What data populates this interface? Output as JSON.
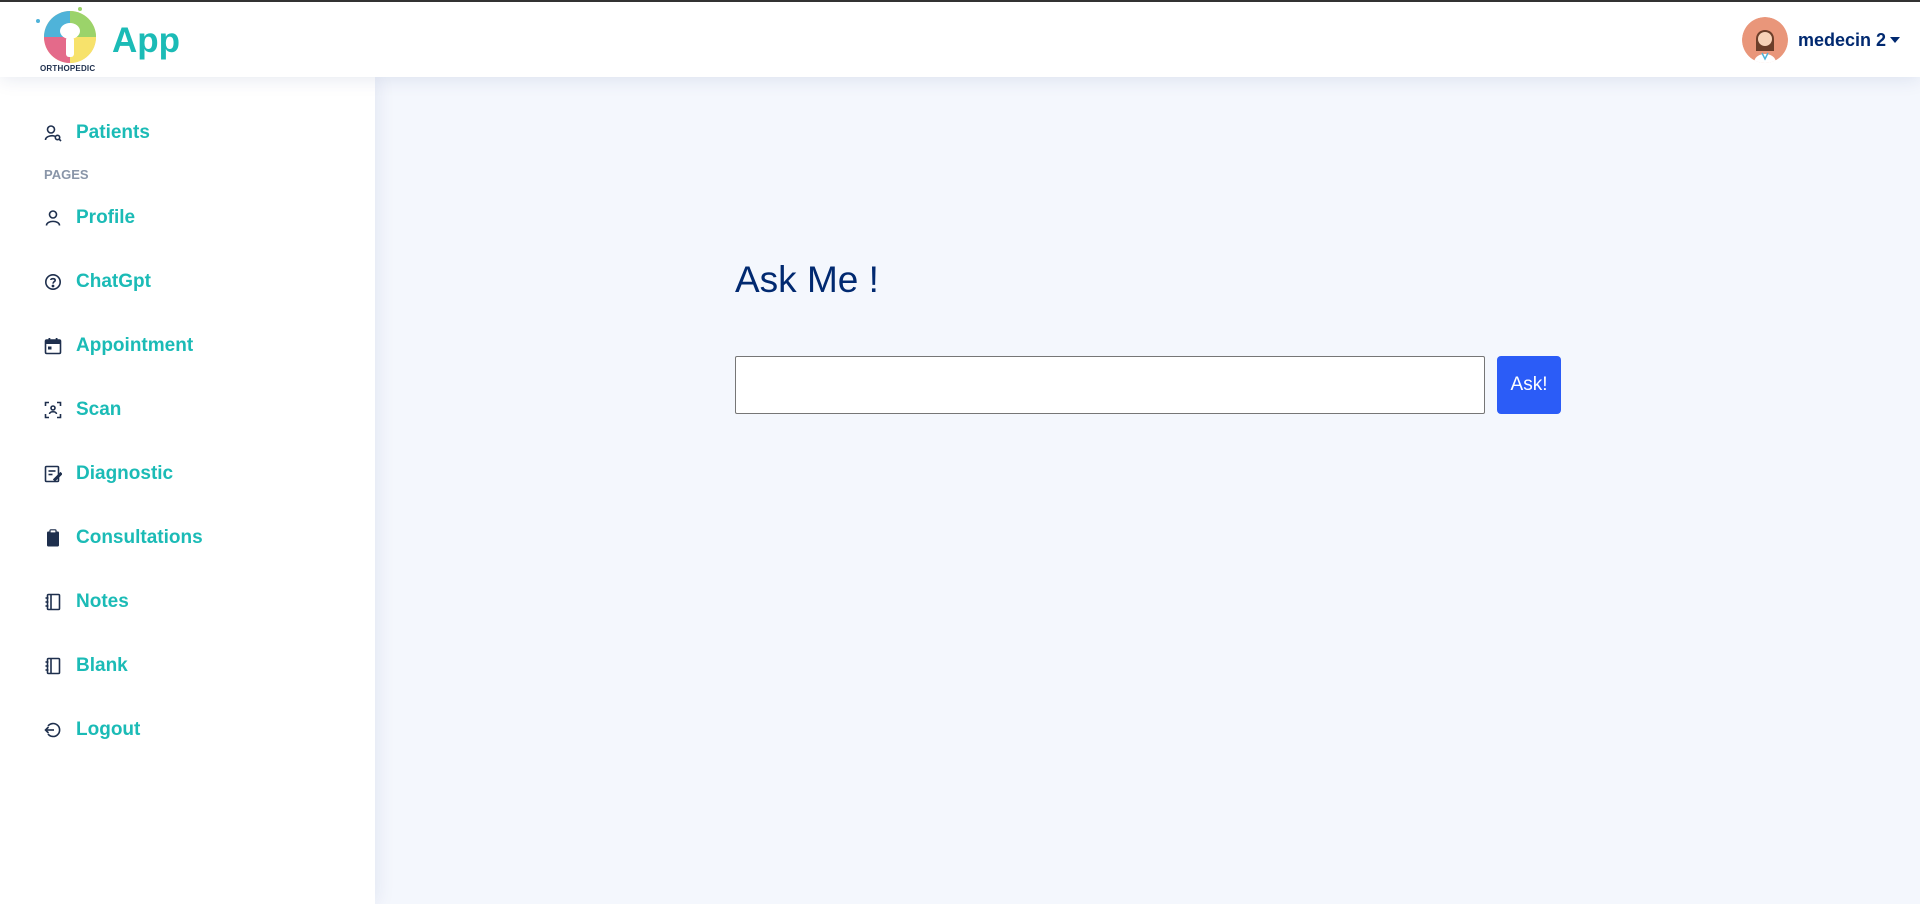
{
  "header": {
    "logo_text": "App",
    "logo_subtext": "ORTHOPEDIC",
    "user_name": "medecin 2"
  },
  "sidebar": {
    "top_item": {
      "label": "Patients",
      "icon": "patient-search-icon"
    },
    "section_heading": "PAGES",
    "items": [
      {
        "label": "Profile",
        "icon": "person-icon"
      },
      {
        "label": "ChatGpt",
        "icon": "question-circle-icon"
      },
      {
        "label": "Appointment",
        "icon": "calendar-icon"
      },
      {
        "label": "Scan",
        "icon": "scan-icon"
      },
      {
        "label": "Diagnostic",
        "icon": "edit-document-icon"
      },
      {
        "label": "Consultations",
        "icon": "clipboard-icon"
      },
      {
        "label": "Notes",
        "icon": "journal-icon"
      },
      {
        "label": "Blank",
        "icon": "journal-icon"
      },
      {
        "label": "Logout",
        "icon": "logout-icon"
      }
    ]
  },
  "main": {
    "title": "Ask Me !",
    "input_value": "",
    "button_label": "Ask!"
  },
  "colors": {
    "accent": "#1bbbb6",
    "navy": "#012970",
    "button": "#2b5cf7",
    "background": "#f4f7fd"
  }
}
